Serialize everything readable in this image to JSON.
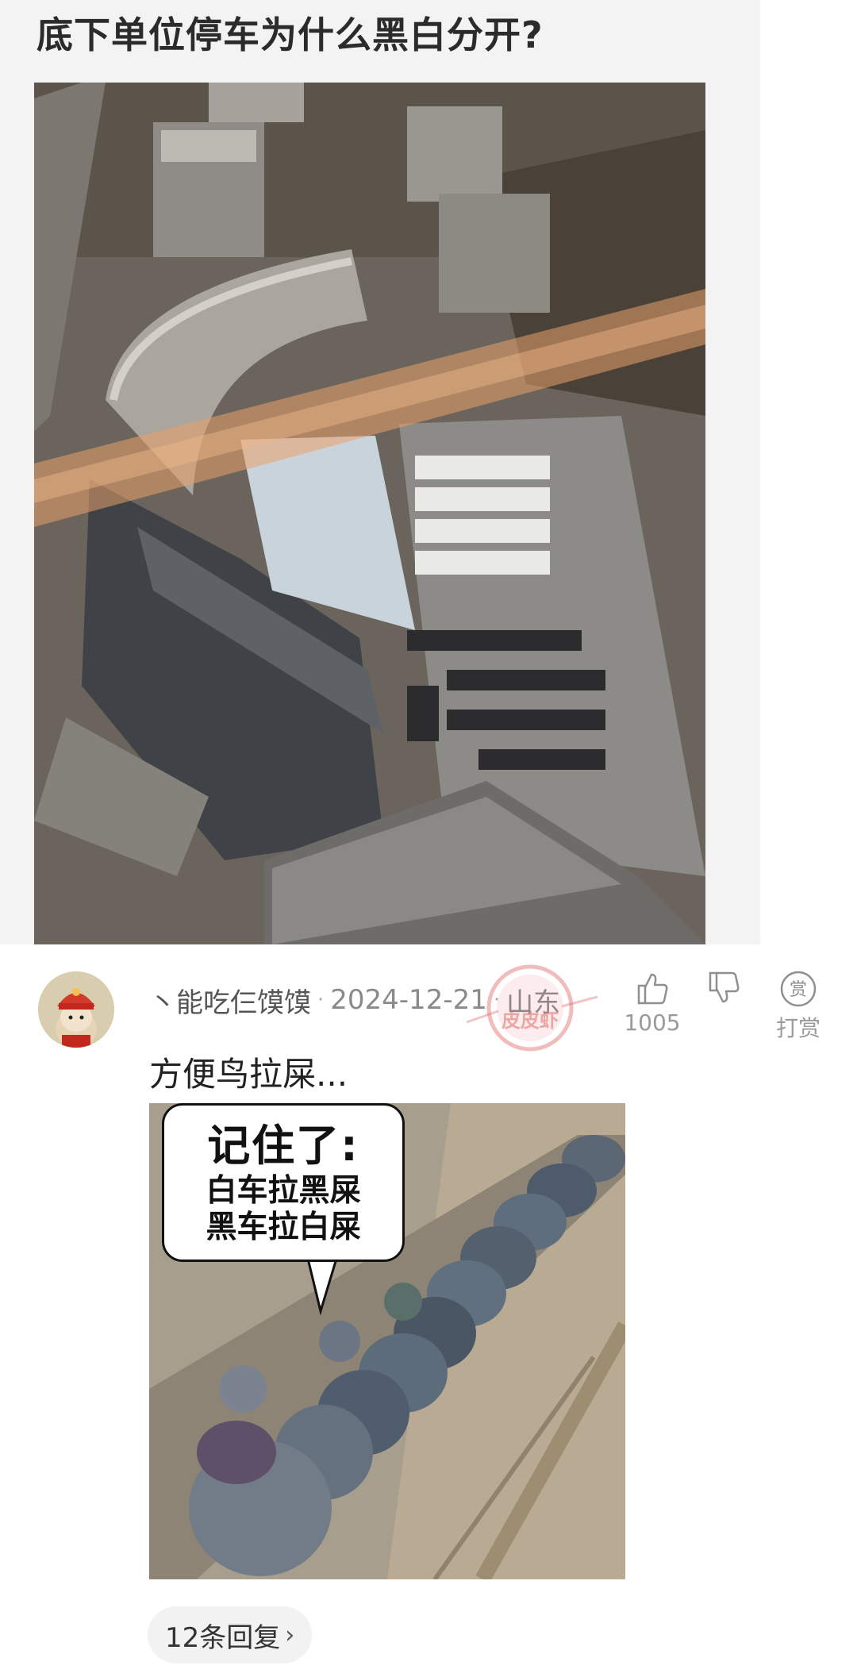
{
  "post": {
    "title": "底下单位停车为什么黑白分开?"
  },
  "comment": {
    "username": "丶能吃仨馍馍",
    "date": "2024-12-21",
    "location": "山东",
    "separator": "·",
    "text": "方便鸟拉屎...",
    "like_count": "1005",
    "tip_label": "打赏",
    "tip_icon_char": "赏",
    "replies_label": "12条回复",
    "replies_chevron": "›"
  },
  "meme": {
    "line1": "记住了:",
    "line2": "白车拉黑屎",
    "line3": "黑车拉白屎"
  },
  "watermark": {
    "text": "皮皮虾"
  },
  "icons": {
    "like": "thumbs-up-icon",
    "dislike": "thumbs-down-icon",
    "tip": "reward-icon"
  },
  "colors": {
    "watermark": "#e06b6b",
    "glare": "#e8a06a"
  }
}
